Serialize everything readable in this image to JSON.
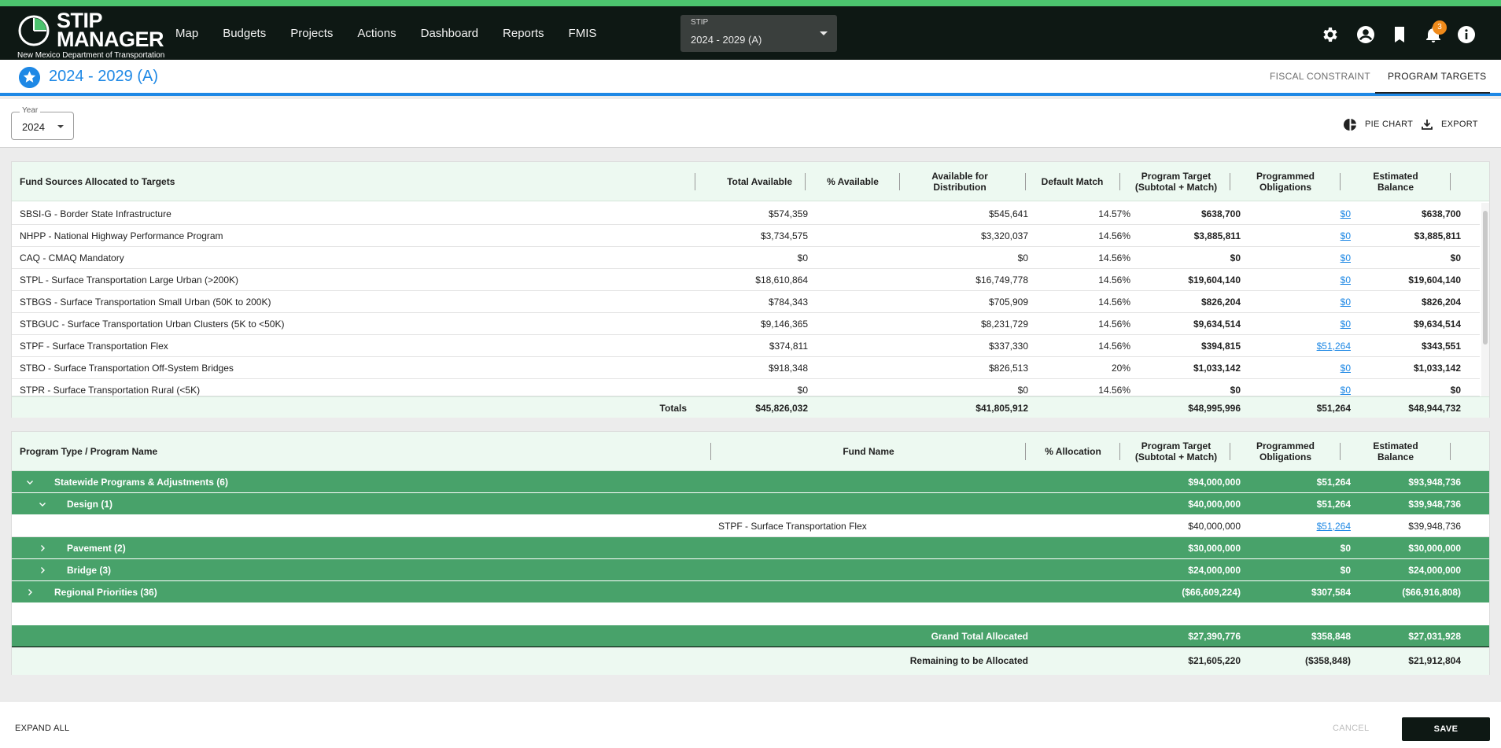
{
  "app": {
    "logo_title": "STIP\nMANAGER",
    "logo_subtitle": "New Mexico Department of Transportation",
    "nav": [
      "Map",
      "Budgets",
      "Projects",
      "Actions",
      "Dashboard",
      "Reports",
      "FMIS"
    ],
    "stip_label": "STIP",
    "stip_value": "2024 - 2029 (A)",
    "notification_count": "3",
    "icons": [
      "gear-icon",
      "account-icon",
      "bookmark-icon",
      "bell-icon",
      "info-icon"
    ],
    "accent_color": "#4cc36e",
    "brand_blue": "#1e88e5",
    "group_green": "#48a26a"
  },
  "header": {
    "title": "2024 - 2029 (A)",
    "tabs": [
      "FISCAL CONSTRAINT",
      "PROGRAM TARGETS"
    ],
    "active_tab": "PROGRAM TARGETS"
  },
  "toolbar": {
    "year_label": "Year",
    "year_value": "2024",
    "pie_chart": "PIE CHART",
    "export": "EXPORT"
  },
  "funds": {
    "headers": {
      "source": "Fund Sources Allocated to Targets",
      "total_available": "Total Available",
      "pct_available": "% Available",
      "available_distribution": "Available for\nDistribution",
      "default_match": "Default Match",
      "program_target": "Program Target\n(Subtotal + Match)",
      "programmed_obligations": "Programmed\nObligations",
      "estimated_balance": "Estimated\nBalance"
    },
    "rows": [
      {
        "name": "SBSI-G - Border State Infrastructure",
        "total": "$574,359",
        "pct": "",
        "dist": "$545,641",
        "match": "14.57%",
        "target": "$638,700",
        "oblig": "$0",
        "balance": "$638,700"
      },
      {
        "name": "NHPP - National Highway Performance Program",
        "total": "$3,734,575",
        "pct": "",
        "dist": "$3,320,037",
        "match": "14.56%",
        "target": "$3,885,811",
        "oblig": "$0",
        "balance": "$3,885,811"
      },
      {
        "name": "CAQ - CMAQ Mandatory",
        "total": "$0",
        "pct": "",
        "dist": "$0",
        "match": "14.56%",
        "target": "$0",
        "oblig": "$0",
        "balance": "$0"
      },
      {
        "name": "STPL - Surface Transportation Large Urban (>200K)",
        "total": "$18,610,864",
        "pct": "",
        "dist": "$16,749,778",
        "match": "14.56%",
        "target": "$19,604,140",
        "oblig": "$0",
        "balance": "$19,604,140"
      },
      {
        "name": "STBGS - Surface Transportation Small Urban (50K to 200K)",
        "total": "$784,343",
        "pct": "",
        "dist": "$705,909",
        "match": "14.56%",
        "target": "$826,204",
        "oblig": "$0",
        "balance": "$826,204"
      },
      {
        "name": "STBGUC - Surface Transportation Urban Clusters (5K to <50K)",
        "total": "$9,146,365",
        "pct": "",
        "dist": "$8,231,729",
        "match": "14.56%",
        "target": "$9,634,514",
        "oblig": "$0",
        "balance": "$9,634,514"
      },
      {
        "name": "STPF - Surface Transportation Flex",
        "total": "$374,811",
        "pct": "",
        "dist": "$337,330",
        "match": "14.56%",
        "target": "$394,815",
        "oblig": "$51,264",
        "balance": "$343,551"
      },
      {
        "name": "STBO - Surface Transportation Off-System Bridges",
        "total": "$918,348",
        "pct": "",
        "dist": "$826,513",
        "match": "20%",
        "target": "$1,033,142",
        "oblig": "$0",
        "balance": "$1,033,142"
      },
      {
        "name": "STPR - Surface Transportation Rural (<5K)",
        "total": "$0",
        "pct": "",
        "dist": "$0",
        "match": "14.56%",
        "target": "$0",
        "oblig": "$0",
        "balance": "$0"
      }
    ],
    "totals": {
      "label": "Totals",
      "total": "$45,826,032",
      "dist": "$41,805,912",
      "target": "$48,995,996",
      "oblig": "$51,264",
      "balance": "$48,944,732"
    }
  },
  "programs": {
    "headers": {
      "program": "Program Type / Program Name",
      "fund_name": "Fund Name",
      "allocation": "% Allocation",
      "program_target": "Program Target\n(Subtotal + Match)",
      "programmed_obligations": "Programmed\nObligations",
      "estimated_balance": "Estimated\nBalance"
    },
    "groups": [
      {
        "label": "Statewide Programs & Adjustments (6)",
        "target": "$94,000,000",
        "oblig": "$51,264",
        "balance": "$93,948,736"
      },
      {
        "label": "Design (1)",
        "target": "$40,000,000",
        "oblig": "$51,264",
        "balance": "$39,948,736"
      },
      {
        "fund": "STPF - Surface Transportation Flex",
        "target": "$40,000,000",
        "oblig": "$51,264",
        "balance": "$39,948,736"
      },
      {
        "label": "Pavement (2)",
        "target": "$30,000,000",
        "oblig": "$0",
        "balance": "$30,000,000"
      },
      {
        "label": "Bridge (3)",
        "target": "$24,000,000",
        "oblig": "$0",
        "balance": "$24,000,000"
      },
      {
        "label": "Regional Priorities (36)",
        "target": "($66,609,224)",
        "oblig": "$307,584",
        "balance": "($66,916,808)"
      }
    ],
    "grand_total": {
      "label": "Grand Total Allocated",
      "target": "$27,390,776",
      "oblig": "$358,848",
      "balance": "$27,031,928"
    },
    "remaining": {
      "label": "Remaining to be Allocated",
      "target": "$21,605,220",
      "oblig": "($358,848)",
      "balance": "$21,912,804"
    }
  },
  "footer": {
    "expand_all": "EXPAND ALL",
    "cancel": "CANCEL",
    "save": "SAVE"
  }
}
